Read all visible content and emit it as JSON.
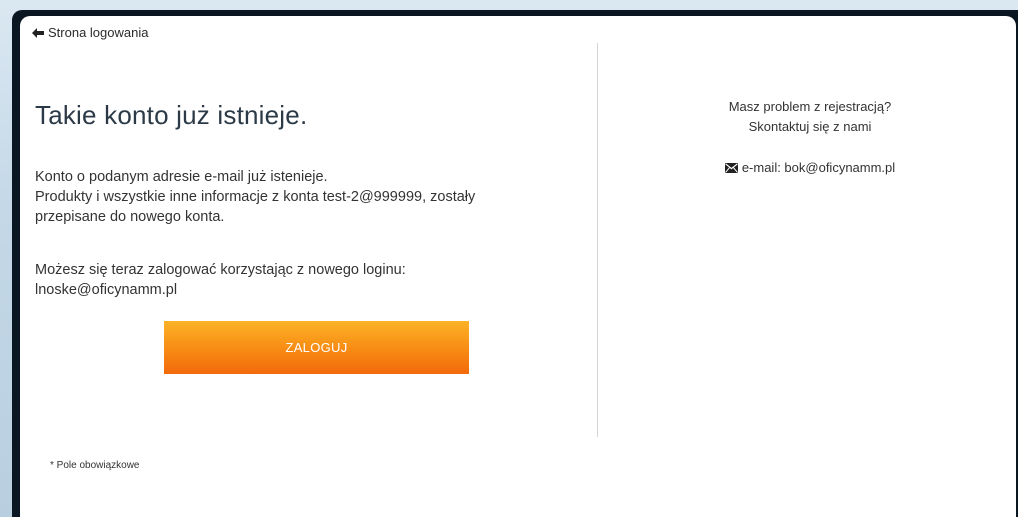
{
  "nav": {
    "back_label": "Strona logowania"
  },
  "main": {
    "title": "Takie konto już istnieje.",
    "paragraph1": [
      "Konto o podanym adresie e-mail już istenieje.",
      "Produkty i wszystkie inne informacje z konta test-2@999999, zostały",
      "przepisane do nowego konta."
    ],
    "paragraph2": [
      "Możesz się teraz zalogować korzystając z nowego loginu:",
      "lnoske@oficynamm.pl"
    ],
    "login_button_label": "ZALOGUJ",
    "required_note": "* Pole obowiązkowe"
  },
  "sidebar": {
    "help_line1": "Masz problem z rejestracją?",
    "help_line2": "Skontaktuj się z nami",
    "email_label": "e-mail: bok@oficynamm.pl"
  },
  "colors": {
    "button_top": "#fcb326",
    "button_bottom": "#f26a0a",
    "title_text": "#2c3a47"
  },
  "icons": {
    "back": "arrow-left-icon",
    "email": "envelope-icon"
  }
}
